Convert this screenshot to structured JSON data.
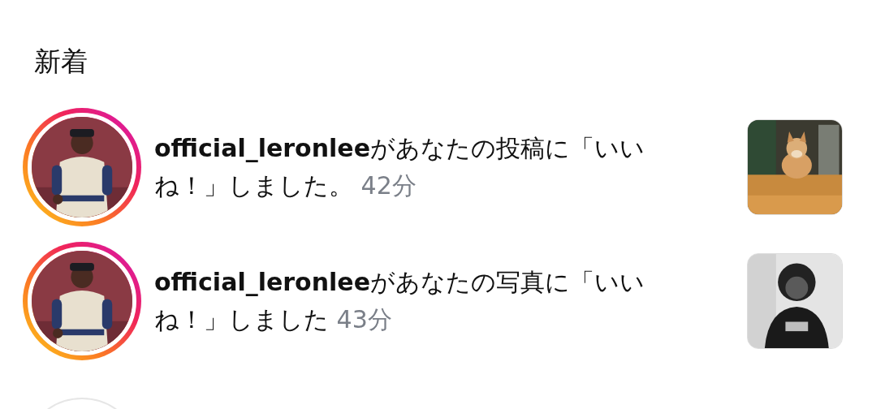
{
  "section": {
    "title": "新着"
  },
  "notifications": [
    {
      "username": "official_leronlee",
      "message": "があなたの投稿に「いいね！」しました。",
      "time": "42分",
      "has_story": true
    },
    {
      "username": "official_leronlee",
      "message": "があなたの写真に「いいね！」しました",
      "time": "43分",
      "has_story": true
    }
  ]
}
